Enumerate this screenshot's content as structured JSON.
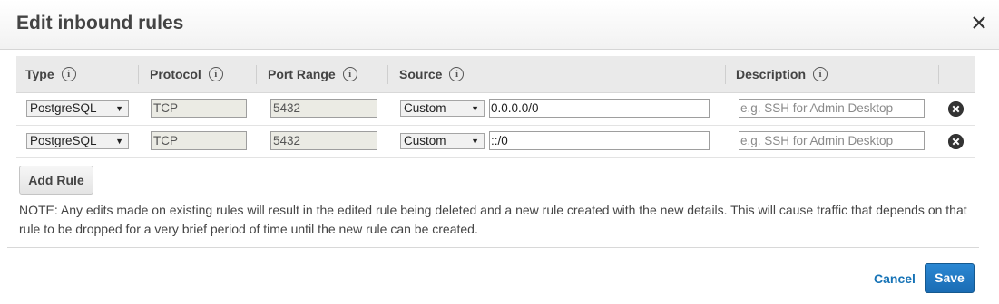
{
  "dialog": {
    "title": "Edit inbound rules",
    "close_icon": "close-icon"
  },
  "table": {
    "headers": {
      "type": "Type",
      "protocol": "Protocol",
      "port_range": "Port Range",
      "source": "Source",
      "description": "Description"
    },
    "rows": [
      {
        "type": "PostgreSQL",
        "protocol": "TCP",
        "port_range": "5432",
        "source_type": "Custom",
        "source_value": "0.0.0.0/0",
        "description_placeholder": "e.g. SSH for Admin Desktop",
        "description_value": ""
      },
      {
        "type": "PostgreSQL",
        "protocol": "TCP",
        "port_range": "5432",
        "source_type": "Custom",
        "source_value": "::/0",
        "description_placeholder": "e.g. SSH for Admin Desktop",
        "description_value": ""
      }
    ]
  },
  "add_rule_label": "Add Rule",
  "note": "NOTE: Any edits made on existing rules will result in the edited rule being deleted and a new rule created with the new details. This will cause traffic that depends on that rule to be dropped for a very brief period of time until the new rule can be created.",
  "footer": {
    "cancel_label": "Cancel",
    "save_label": "Save"
  },
  "colors": {
    "primary_button": "#1a6cb4",
    "link": "#1673b6",
    "header_bg": "#eaeaea"
  }
}
